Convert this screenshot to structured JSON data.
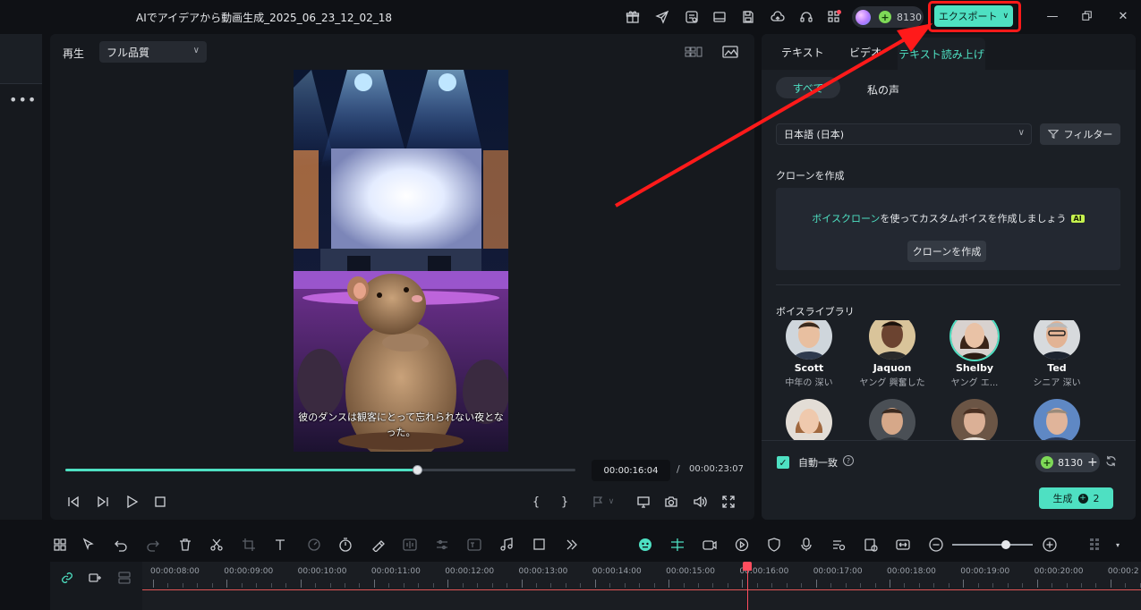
{
  "window": {
    "title": "AIでアイデアから動画生成_2025_06_23_12_02_18",
    "credits": "8130",
    "export_label": "エクスポート",
    "toolbar_icons": [
      "gift-icon",
      "send-icon",
      "task-list-icon",
      "layout-icon",
      "save-icon",
      "cloud-upload-icon",
      "headset-icon",
      "apps-grid-icon"
    ],
    "window_buttons": [
      "minimize-icon",
      "restore-icon",
      "close-icon"
    ]
  },
  "player": {
    "play_label": "再生",
    "quality_value": "フル品質",
    "subtitle": "彼のダンスは観客にとって忘れられない夜となった。",
    "progress_fraction": 0.69,
    "current_time": "00:00:16:04",
    "separator": "/",
    "total_time": "00:00:23:07",
    "left_controls": [
      "prev-frame-icon",
      "next-frame-icon",
      "play-icon",
      "stop-icon"
    ],
    "right_controls": [
      "mark-in-icon",
      "mark-out-icon",
      "marker-flag-icon",
      "display-icon",
      "snapshot-icon",
      "volume-icon",
      "fullscreen-icon"
    ]
  },
  "panel": {
    "tabs": [
      "テキスト",
      "ビデオ",
      "テキスト読み上げ"
    ],
    "active_tab": "テキスト読み上げ",
    "filter_chips": [
      "すべて",
      "私の声"
    ],
    "language": "日本語 (日本)",
    "filter_label": "フィルター",
    "clone_section_title": "クローンを作成",
    "clone_link": "ボイスクローン",
    "clone_text": "を使ってカスタムボイスを作成しましょう",
    "ai_badge": "AI",
    "clone_button": "クローンを作成",
    "library_title": "ボイスライブラリ",
    "voices": [
      {
        "name": "Scott",
        "desc": "中年の 深い",
        "selected": false
      },
      {
        "name": "Jaquon",
        "desc": "ヤング 興奮した",
        "selected": false
      },
      {
        "name": "Shelby",
        "desc": "ヤング エ...",
        "selected": true
      },
      {
        "name": "Ted",
        "desc": "シニア 深い",
        "selected": false
      },
      {
        "name": "",
        "desc": "",
        "selected": false
      },
      {
        "name": "",
        "desc": "",
        "selected": false
      },
      {
        "name": "",
        "desc": "",
        "selected": false
      },
      {
        "name": "",
        "desc": "",
        "selected": false
      }
    ],
    "auto_match_label": "自動一致",
    "auto_match_checked": true,
    "footer_credits": "8130",
    "generate_label": "生成",
    "generate_cost": "2"
  },
  "timeline": {
    "tool_icons": [
      "layout-grid-icon",
      "select-icon",
      "undo-icon",
      "redo-icon",
      "delete-icon",
      "cut-icon",
      "crop-icon",
      "text-icon",
      "speed-icon",
      "timer-icon",
      "color-icon",
      "audio-wave-icon",
      "adjust-icon",
      "text-ai-icon",
      "music-icon",
      "shape-icon",
      "more-icon"
    ],
    "right_icons": [
      "ai-face-icon",
      "split-icon",
      "camera-ai-icon",
      "play-circle-icon",
      "shield-icon",
      "mic-icon",
      "caption-icon",
      "clip-icon",
      "fit-icon",
      "zoom-out-icon",
      "zoom-in-icon",
      "grid-menu-icon"
    ],
    "zoom_fraction": 0.67,
    "ruler_labels": [
      "00:00:08:00",
      "00:00:09:00",
      "00:00:10:00",
      "00:00:11:00",
      "00:00:12:00",
      "00:00:13:00",
      "00:00:14:00",
      "00:00:15:00",
      "00:00:16:00",
      "00:00:17:00",
      "00:00:18:00",
      "00:00:19:00",
      "00:00:20:00",
      "00:00:2"
    ],
    "ruler_start_seconds": 8,
    "playhead_seconds": 16.07
  },
  "colors": {
    "accent": "#4ee0c2",
    "highlight_red": "#ff1a1a",
    "playhead": "#ff4d5e",
    "background": "#0f1115",
    "panel": "#1b1f25"
  }
}
